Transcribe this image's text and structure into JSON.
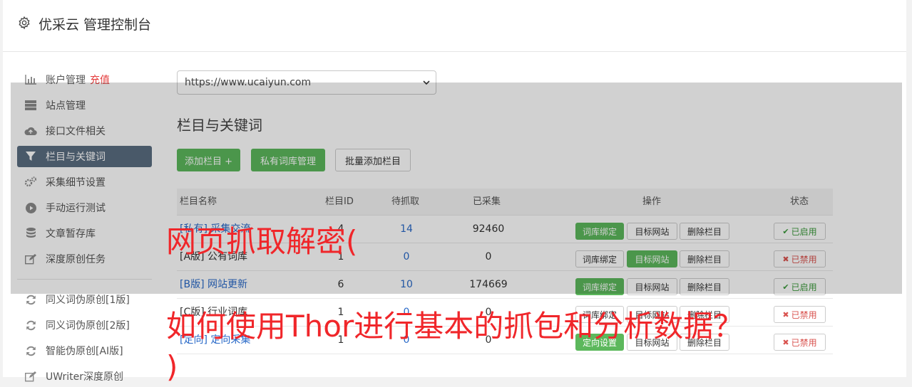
{
  "header": {
    "title": "优采云 管理控制台",
    "icon": "gear-icon"
  },
  "sidebar": {
    "items": [
      {
        "label": "账户管理",
        "icon": "bar-chart-icon",
        "badge": "充值"
      },
      {
        "label": "站点管理",
        "icon": "server-icon"
      },
      {
        "label": "接口文件相关",
        "icon": "cloud-upload-icon"
      },
      {
        "label": "栏目与关键词",
        "icon": "filter-icon",
        "active": true
      },
      {
        "label": "采集细节设置",
        "icon": "cogs-icon"
      },
      {
        "label": "手动运行测试",
        "icon": "play-circle-icon"
      },
      {
        "label": "文章暂存库",
        "icon": "database-icon"
      },
      {
        "label": "深度原创任务",
        "icon": "edit-icon"
      },
      {
        "label": "同义词伪原创[1版]",
        "icon": "refresh-icon"
      },
      {
        "label": "同义词伪原创[2版]",
        "icon": "refresh-icon"
      },
      {
        "label": "智能伪原创[AI版]",
        "icon": "refresh-icon"
      },
      {
        "label": "UWriter深度原创",
        "icon": "edit-icon"
      }
    ]
  },
  "site_select": {
    "value": "https://www.ucaiyun.com"
  },
  "section": {
    "title": "栏目与关键词"
  },
  "toolbar": {
    "add_column": "添加栏目 +",
    "private_lexicon": "私有词库管理",
    "batch_add": "批量添加栏目"
  },
  "table": {
    "headers": [
      "栏目名称",
      "栏目ID",
      "待抓取",
      "已采集",
      "操作",
      "状态"
    ],
    "rows": [
      {
        "name": "[私有] 采集交流",
        "id": "4",
        "pending": "14",
        "collected": "92460",
        "btn1": "词库绑定",
        "btn2": "目标网站",
        "btn3": "删除栏目",
        "status": "已启用",
        "enabled": true,
        "btn1_hl": true,
        "btn2_hl": false
      },
      {
        "name": "[A版] 公有词库",
        "id": "1",
        "pending": "0",
        "collected": "0",
        "btn1": "词库绑定",
        "btn2": "目标网站",
        "btn3": "删除栏目",
        "status": "已禁用",
        "enabled": false,
        "btn1_hl": false,
        "btn2_hl": true
      },
      {
        "name": "[B版] 网站更新",
        "id": "6",
        "pending": "10",
        "collected": "174669",
        "btn1": "词库绑定",
        "btn2": "目标网站",
        "btn3": "删除栏目",
        "status": "已启用",
        "enabled": true,
        "btn1_hl": true,
        "btn2_hl": false
      },
      {
        "name": "[C版] 行业词库",
        "id": "1",
        "pending": "0",
        "collected": "0",
        "btn1": "词库绑定",
        "btn2": "目标网站",
        "btn3": "删除栏目",
        "status": "已禁用",
        "enabled": false,
        "btn1_hl": false,
        "btn2_hl": false
      },
      {
        "name": "[定向] 定向采集",
        "id": "1",
        "pending": "0",
        "collected": "0",
        "btn1": "定向设置",
        "btn2": "目标网站",
        "btn3": "删除栏目",
        "status": "已禁用",
        "enabled": false,
        "btn1_hl": true,
        "btn2_hl": false
      }
    ]
  },
  "watermark": {
    "line1": "网页抓取解密(",
    "line2": "如何使用Thor进行基本的抓包和分析数据？",
    "line3": ")"
  },
  "colors": {
    "accent_green": "#5cb85c",
    "active_sidebar": "#5a6d80",
    "link_blue": "#2a6ac8",
    "danger_red": "#d9534f",
    "watermark_red": "#f0262a"
  }
}
